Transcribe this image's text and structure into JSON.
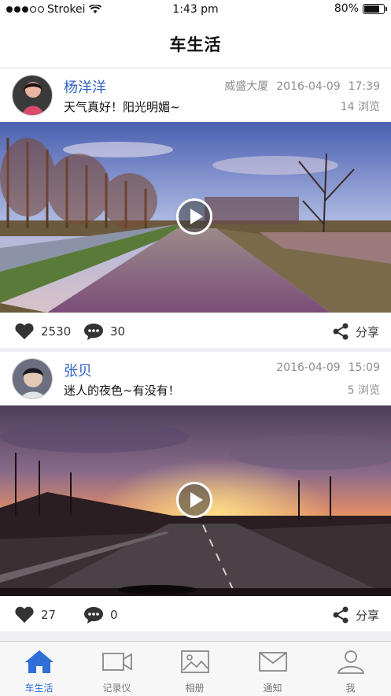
{
  "status_bar": {
    "carrier": "Strokei",
    "time": "1:43 pm",
    "battery": "80%",
    "battery_level": 0.8
  },
  "nav": {
    "title": "车生活"
  },
  "posts": [
    {
      "username": "杨洋洋",
      "caption": "天气真好！阳光明媚~",
      "location": "威盛大厦",
      "date": "2016-04-09",
      "time": "17:39",
      "views": "14 浏览",
      "likes": "2530",
      "comments": "30",
      "share_label": "分享"
    },
    {
      "username": "张贝",
      "caption": "迷人的夜色~有没有！",
      "location": "",
      "date": "2016-04-09",
      "time": "15:09",
      "views": "5 浏览",
      "likes": "27",
      "comments": "0",
      "share_label": "分享"
    }
  ],
  "tabs": [
    {
      "label": "车生活",
      "icon": "home-icon",
      "active": true
    },
    {
      "label": "记录仪",
      "icon": "video-camera-icon",
      "active": false
    },
    {
      "label": "相册",
      "icon": "photo-album-icon",
      "active": false
    },
    {
      "label": "通知",
      "icon": "envelope-icon",
      "active": false
    },
    {
      "label": "我",
      "icon": "user-icon",
      "active": false
    }
  ],
  "colors": {
    "accent": "#2f6fd6",
    "username": "#2f62c8"
  }
}
